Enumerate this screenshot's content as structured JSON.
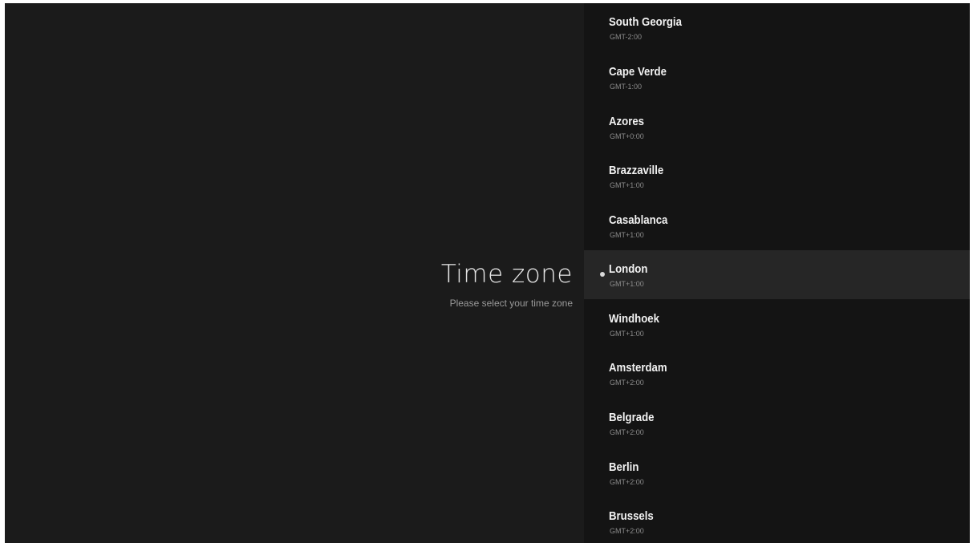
{
  "setup": {
    "title": "Time zone",
    "subtitle": "Please select your time zone"
  },
  "timezones": [
    {
      "name": "South Georgia",
      "offset": "GMT-2:00"
    },
    {
      "name": "Cape Verde",
      "offset": "GMT-1:00"
    },
    {
      "name": "Azores",
      "offset": "GMT+0:00"
    },
    {
      "name": "Brazzaville",
      "offset": "GMT+1:00"
    },
    {
      "name": "Casablanca",
      "offset": "GMT+1:00"
    },
    {
      "name": "London",
      "offset": "GMT+1:00",
      "selected": true
    },
    {
      "name": "Windhoek",
      "offset": "GMT+1:00"
    },
    {
      "name": "Amsterdam",
      "offset": "GMT+2:00"
    },
    {
      "name": "Belgrade",
      "offset": "GMT+2:00"
    },
    {
      "name": "Berlin",
      "offset": "GMT+2:00"
    },
    {
      "name": "Brussels",
      "offset": "GMT+2:00"
    }
  ],
  "colors": {
    "background": "#1b1b1b",
    "list_background": "#141414",
    "selected_row": "#262626"
  }
}
